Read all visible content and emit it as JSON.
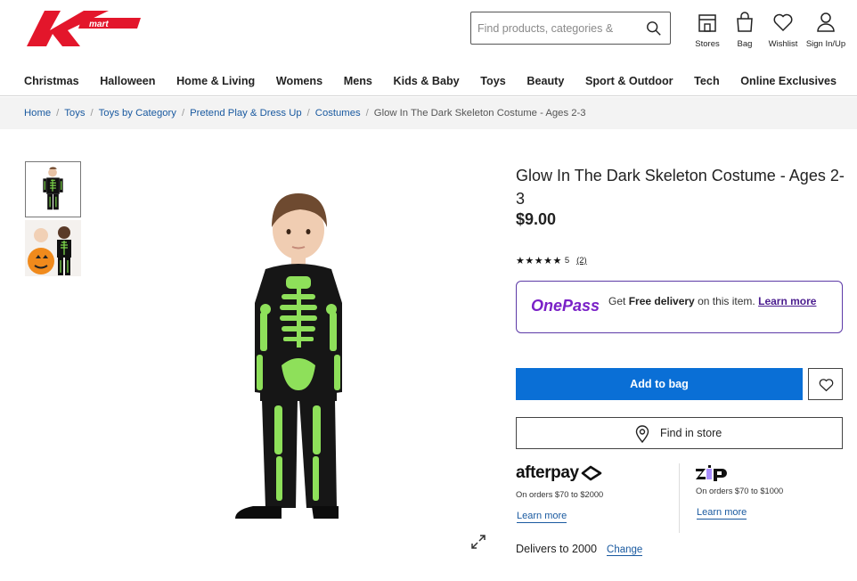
{
  "brand": {
    "name": "Kmart",
    "primary_color": "#e3162b"
  },
  "search": {
    "placeholder": "Find products, categories &"
  },
  "header_actions": [
    {
      "label": "Stores",
      "icon": "store-icon"
    },
    {
      "label": "Bag",
      "icon": "bag-icon"
    },
    {
      "label": "Wishlist",
      "icon": "heart-icon"
    },
    {
      "label": "Sign In/Up",
      "icon": "user-icon"
    }
  ],
  "nav": [
    "Christmas",
    "Halloween",
    "Home & Living",
    "Womens",
    "Mens",
    "Kids & Baby",
    "Toys",
    "Beauty",
    "Sport & Outdoor",
    "Tech",
    "Online Exclusives"
  ],
  "breadcrumb": [
    "Home",
    "Toys",
    "Toys by Category",
    "Pretend Play & Dress Up",
    "Costumes",
    "Glow In The Dark Skeleton Costume - Ages 2-3"
  ],
  "product": {
    "title": "Glow In The Dark Skeleton Costume - Ages 2-3",
    "price": "$9.00",
    "rating": {
      "stars": 5,
      "value": "5",
      "count": "(2)"
    }
  },
  "onepass": {
    "logo": "OnePass",
    "text_prefix": "Get ",
    "text_bold": "Free delivery",
    "text_suffix": " on this item. ",
    "link": "Learn more",
    "accent": "#7a21c7"
  },
  "actions": {
    "add_to_bag": "Add to bag",
    "find_in_store": "Find in store",
    "button_color": "#0a6fd6"
  },
  "afterpay": {
    "logo": "afterpay",
    "orders": "On orders $70 to $2000",
    "link": "Learn more"
  },
  "zip": {
    "logo": "zip",
    "orders": "On orders $70 to $1000",
    "link": "Learn more"
  },
  "delivery": {
    "text": "Delivers to 2000",
    "link": "Change"
  }
}
